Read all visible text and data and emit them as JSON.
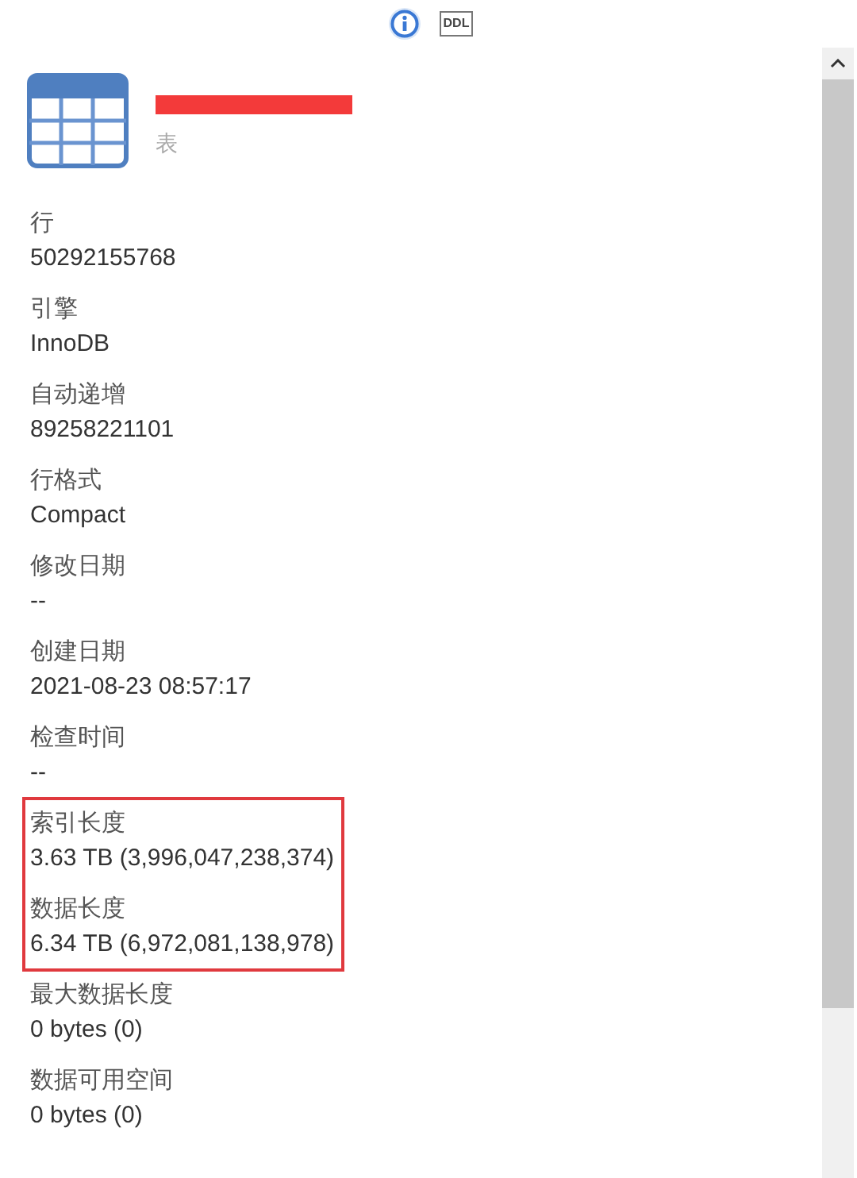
{
  "toolbar": {
    "buttons": [
      {
        "kind": "info",
        "selected": true
      },
      {
        "kind": "ddl",
        "label": "DDL",
        "selected": false
      }
    ]
  },
  "header": {
    "name_redacted": true,
    "type": "表"
  },
  "fields": [
    {
      "label": "行",
      "value": "50292155768",
      "highlighted": false
    },
    {
      "label": "引擎",
      "value": "InnoDB",
      "highlighted": false
    },
    {
      "label": "自动递增",
      "value": "89258221101",
      "highlighted": false
    },
    {
      "label": "行格式",
      "value": "Compact",
      "highlighted": false
    },
    {
      "label": "修改日期",
      "value": "--",
      "highlighted": false
    },
    {
      "label": "创建日期",
      "value": "2021-08-23 08:57:17",
      "highlighted": false
    },
    {
      "label": "检查时间",
      "value": "--",
      "highlighted": false
    },
    {
      "label": "索引长度",
      "value": "3.63 TB (3,996,047,238,374)",
      "highlighted": true
    },
    {
      "label": "数据长度",
      "value": "6.34 TB (6,972,081,138,978)",
      "highlighted": true
    },
    {
      "label": "最大数据长度",
      "value": "0 bytes (0)",
      "highlighted": false
    },
    {
      "label": "数据可用空间",
      "value": "0 bytes (0)",
      "highlighted": false
    }
  ]
}
